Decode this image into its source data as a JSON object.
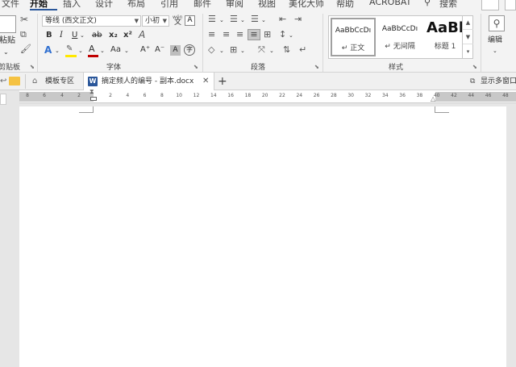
{
  "menu": {
    "items": [
      "文件",
      "开始",
      "插入",
      "设计",
      "布局",
      "引用",
      "邮件",
      "审阅",
      "视图",
      "美化大师",
      "帮助",
      "ACROBAT"
    ],
    "active": "开始",
    "search_label": "搜索"
  },
  "clipboard": {
    "paste_label": "粘贴",
    "group_label": "剪贴板"
  },
  "font": {
    "font_name": "等线 (西文正文)",
    "font_size": "小初",
    "wen_label": "wén",
    "char_border_label": "A",
    "bold": "B",
    "italic": "I",
    "underline": "U",
    "strikethrough": "ab",
    "subscript": "x₂",
    "superscript": "x²",
    "clear_format": "A",
    "text_effect": "A",
    "highlight": "ab",
    "font_color": "A",
    "change_case": "Aa",
    "grow": "A⁺",
    "shrink": "A⁻",
    "char_shading": "A",
    "enclose": "字",
    "group_label": "字体",
    "highlight_color": "#ffe800",
    "font_color_value": "#c00000"
  },
  "paragraph": {
    "group_label": "段落"
  },
  "styles": {
    "items": [
      {
        "sample": "AaBbCcDı",
        "name": "↵ 正文"
      },
      {
        "sample": "AaBbCcDı",
        "name": "↵ 无间隔"
      },
      {
        "sample": "AaBl",
        "name": "标题 1"
      }
    ],
    "group_label": "样式"
  },
  "editing": {
    "label": "编辑"
  },
  "tabs": {
    "template_zone": "模板专区",
    "doc_title": "摘定频人的编号 - 副本.docx",
    "show_multi": "显示多窗口",
    "close_glyph": "✕",
    "add_glyph": "+"
  },
  "ruler": {
    "left_ticks": [
      "8",
      "6",
      "4",
      "2"
    ],
    "right_ticks": [
      "2",
      "4",
      "6",
      "8",
      "10",
      "12",
      "14",
      "16",
      "18",
      "20",
      "22",
      "24",
      "26",
      "28",
      "30",
      "32",
      "34",
      "36",
      "38",
      "40",
      "42",
      "44",
      "46",
      "48"
    ]
  },
  "colors": {
    "accent": "#2b579a",
    "word_blue": "#2b579a"
  }
}
